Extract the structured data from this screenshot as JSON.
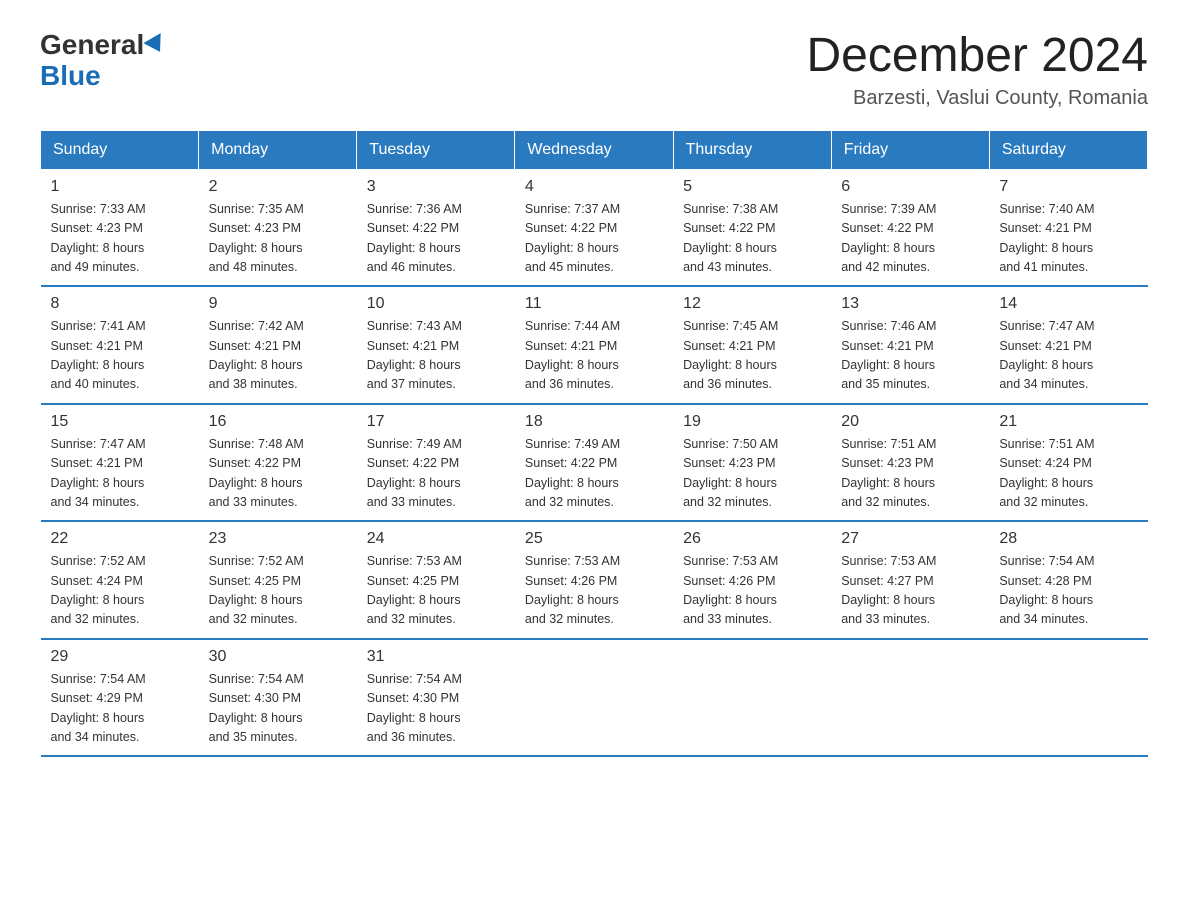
{
  "header": {
    "logo_general": "General",
    "logo_blue": "Blue",
    "month_title": "December 2024",
    "location": "Barzesti, Vaslui County, Romania"
  },
  "weekdays": [
    "Sunday",
    "Monday",
    "Tuesday",
    "Wednesday",
    "Thursday",
    "Friday",
    "Saturday"
  ],
  "weeks": [
    [
      {
        "day": "1",
        "sunrise": "7:33 AM",
        "sunset": "4:23 PM",
        "daylight": "8 hours and 49 minutes."
      },
      {
        "day": "2",
        "sunrise": "7:35 AM",
        "sunset": "4:23 PM",
        "daylight": "8 hours and 48 minutes."
      },
      {
        "day": "3",
        "sunrise": "7:36 AM",
        "sunset": "4:22 PM",
        "daylight": "8 hours and 46 minutes."
      },
      {
        "day": "4",
        "sunrise": "7:37 AM",
        "sunset": "4:22 PM",
        "daylight": "8 hours and 45 minutes."
      },
      {
        "day": "5",
        "sunrise": "7:38 AM",
        "sunset": "4:22 PM",
        "daylight": "8 hours and 43 minutes."
      },
      {
        "day": "6",
        "sunrise": "7:39 AM",
        "sunset": "4:22 PM",
        "daylight": "8 hours and 42 minutes."
      },
      {
        "day": "7",
        "sunrise": "7:40 AM",
        "sunset": "4:21 PM",
        "daylight": "8 hours and 41 minutes."
      }
    ],
    [
      {
        "day": "8",
        "sunrise": "7:41 AM",
        "sunset": "4:21 PM",
        "daylight": "8 hours and 40 minutes."
      },
      {
        "day": "9",
        "sunrise": "7:42 AM",
        "sunset": "4:21 PM",
        "daylight": "8 hours and 38 minutes."
      },
      {
        "day": "10",
        "sunrise": "7:43 AM",
        "sunset": "4:21 PM",
        "daylight": "8 hours and 37 minutes."
      },
      {
        "day": "11",
        "sunrise": "7:44 AM",
        "sunset": "4:21 PM",
        "daylight": "8 hours and 36 minutes."
      },
      {
        "day": "12",
        "sunrise": "7:45 AM",
        "sunset": "4:21 PM",
        "daylight": "8 hours and 36 minutes."
      },
      {
        "day": "13",
        "sunrise": "7:46 AM",
        "sunset": "4:21 PM",
        "daylight": "8 hours and 35 minutes."
      },
      {
        "day": "14",
        "sunrise": "7:47 AM",
        "sunset": "4:21 PM",
        "daylight": "8 hours and 34 minutes."
      }
    ],
    [
      {
        "day": "15",
        "sunrise": "7:47 AM",
        "sunset": "4:21 PM",
        "daylight": "8 hours and 34 minutes."
      },
      {
        "day": "16",
        "sunrise": "7:48 AM",
        "sunset": "4:22 PM",
        "daylight": "8 hours and 33 minutes."
      },
      {
        "day": "17",
        "sunrise": "7:49 AM",
        "sunset": "4:22 PM",
        "daylight": "8 hours and 33 minutes."
      },
      {
        "day": "18",
        "sunrise": "7:49 AM",
        "sunset": "4:22 PM",
        "daylight": "8 hours and 32 minutes."
      },
      {
        "day": "19",
        "sunrise": "7:50 AM",
        "sunset": "4:23 PM",
        "daylight": "8 hours and 32 minutes."
      },
      {
        "day": "20",
        "sunrise": "7:51 AM",
        "sunset": "4:23 PM",
        "daylight": "8 hours and 32 minutes."
      },
      {
        "day": "21",
        "sunrise": "7:51 AM",
        "sunset": "4:24 PM",
        "daylight": "8 hours and 32 minutes."
      }
    ],
    [
      {
        "day": "22",
        "sunrise": "7:52 AM",
        "sunset": "4:24 PM",
        "daylight": "8 hours and 32 minutes."
      },
      {
        "day": "23",
        "sunrise": "7:52 AM",
        "sunset": "4:25 PM",
        "daylight": "8 hours and 32 minutes."
      },
      {
        "day": "24",
        "sunrise": "7:53 AM",
        "sunset": "4:25 PM",
        "daylight": "8 hours and 32 minutes."
      },
      {
        "day": "25",
        "sunrise": "7:53 AM",
        "sunset": "4:26 PM",
        "daylight": "8 hours and 32 minutes."
      },
      {
        "day": "26",
        "sunrise": "7:53 AM",
        "sunset": "4:26 PM",
        "daylight": "8 hours and 33 minutes."
      },
      {
        "day": "27",
        "sunrise": "7:53 AM",
        "sunset": "4:27 PM",
        "daylight": "8 hours and 33 minutes."
      },
      {
        "day": "28",
        "sunrise": "7:54 AM",
        "sunset": "4:28 PM",
        "daylight": "8 hours and 34 minutes."
      }
    ],
    [
      {
        "day": "29",
        "sunrise": "7:54 AM",
        "sunset": "4:29 PM",
        "daylight": "8 hours and 34 minutes."
      },
      {
        "day": "30",
        "sunrise": "7:54 AM",
        "sunset": "4:30 PM",
        "daylight": "8 hours and 35 minutes."
      },
      {
        "day": "31",
        "sunrise": "7:54 AM",
        "sunset": "4:30 PM",
        "daylight": "8 hours and 36 minutes."
      },
      null,
      null,
      null,
      null
    ]
  ],
  "labels": {
    "sunrise": "Sunrise:",
    "sunset": "Sunset:",
    "daylight": "Daylight:"
  }
}
